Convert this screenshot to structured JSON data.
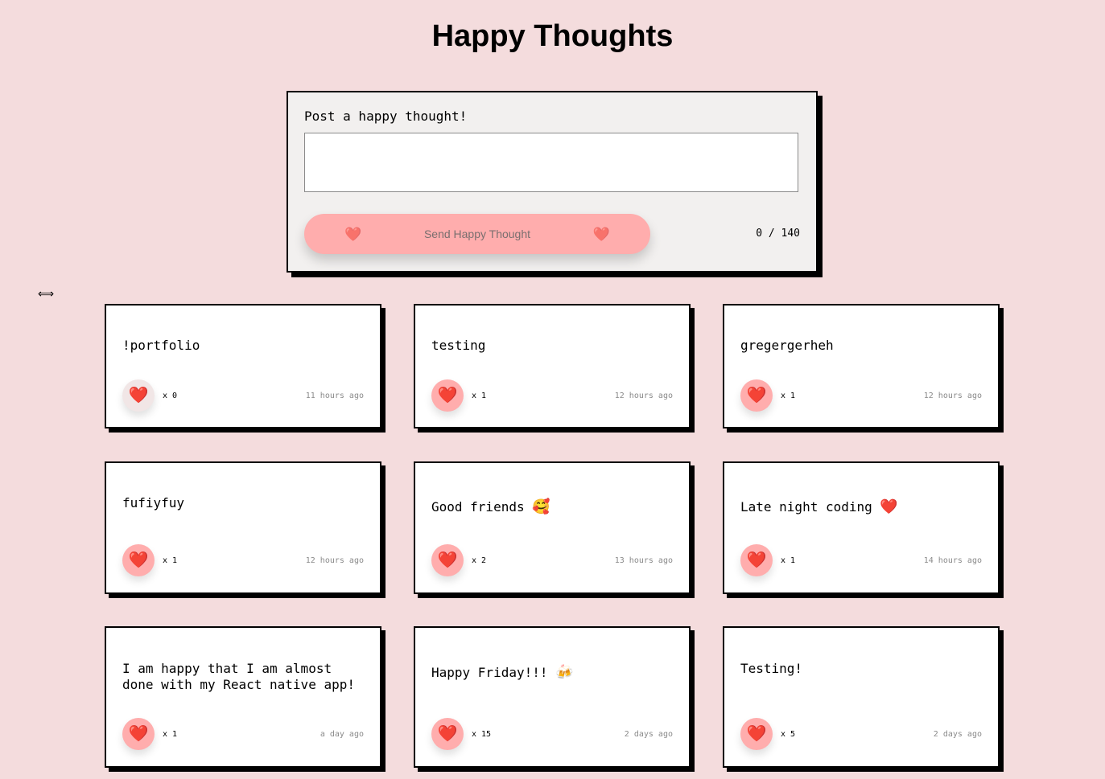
{
  "header": {
    "title": "Happy Thoughts"
  },
  "form": {
    "label": "Post a happy thought!",
    "textarea_value": "",
    "textarea_placeholder": "",
    "send_label": "Send Happy Thought",
    "heart_icon": "❤️",
    "char_count": "0 / 140"
  },
  "colors": {
    "background": "#f4dcdd",
    "accent": "#ffadad",
    "heart": "#ee1111"
  },
  "thoughts": [
    {
      "message": "!portfolio",
      "emoji": "",
      "likes_label": "x 0",
      "time": "11 hours ago"
    },
    {
      "message": "testing",
      "emoji": "",
      "likes_label": "x 1",
      "time": "12 hours ago"
    },
    {
      "message": "gregergerheh",
      "emoji": "",
      "likes_label": "x 1",
      "time": "12 hours ago"
    },
    {
      "message": "fufiyfuy",
      "emoji": "",
      "likes_label": "x 1",
      "time": "12 hours ago"
    },
    {
      "message": "Good friends ",
      "emoji": "🥰",
      "likes_label": "x 2",
      "time": "13 hours ago"
    },
    {
      "message": "Late night coding ",
      "emoji": "❤️",
      "likes_label": "x 1",
      "time": "14 hours ago"
    },
    {
      "message": "I am happy that I am almost done with my React native app!",
      "emoji": "",
      "likes_label": "x 1",
      "time": "a day ago"
    },
    {
      "message": "Happy Friday!!! ",
      "emoji": "🍻",
      "likes_label": "x 15",
      "time": "2 days ago"
    },
    {
      "message": "Testing!",
      "emoji": "",
      "likes_label": "x 5",
      "time": "2 days ago"
    }
  ]
}
